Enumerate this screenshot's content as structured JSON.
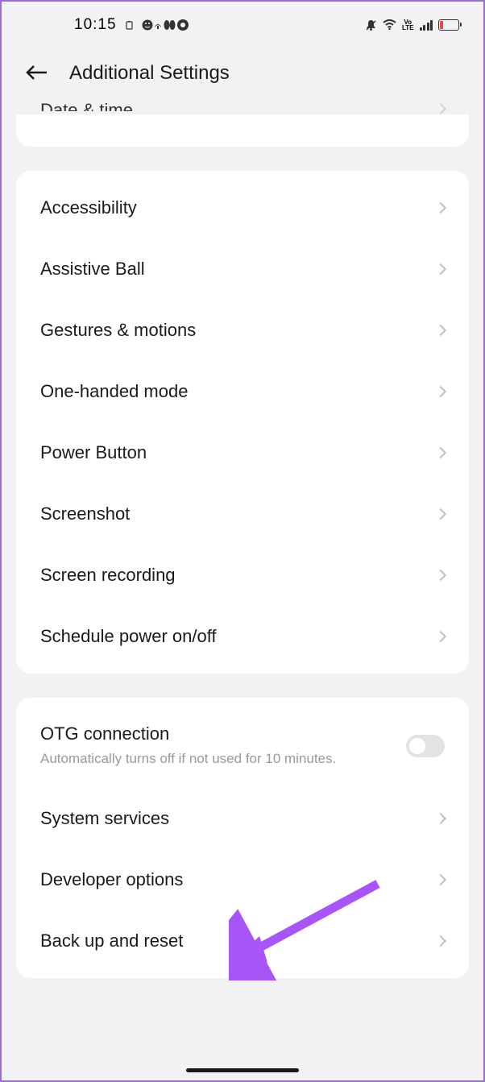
{
  "status": {
    "time": "10:15",
    "battery_low": true
  },
  "header": {
    "title": "Additional Settings"
  },
  "partial_row": {
    "label": "Date & time"
  },
  "section1": [
    {
      "label": "Accessibility",
      "name": "accessibility"
    },
    {
      "label": "Assistive Ball",
      "name": "assistive-ball"
    },
    {
      "label": "Gestures & motions",
      "name": "gestures-motions"
    },
    {
      "label": "One-handed mode",
      "name": "one-handed-mode"
    },
    {
      "label": "Power Button",
      "name": "power-button"
    },
    {
      "label": "Screenshot",
      "name": "screenshot"
    },
    {
      "label": "Screen recording",
      "name": "screen-recording"
    },
    {
      "label": "Schedule power on/off",
      "name": "schedule-power"
    }
  ],
  "section2": {
    "otg": {
      "label": "OTG connection",
      "sub": "Automatically turns off if not used for 10 minutes.",
      "enabled": false
    },
    "items": [
      {
        "label": "System services",
        "name": "system-services"
      },
      {
        "label": "Developer options",
        "name": "developer-options"
      },
      {
        "label": "Back up and reset",
        "name": "back-up-reset"
      }
    ]
  }
}
